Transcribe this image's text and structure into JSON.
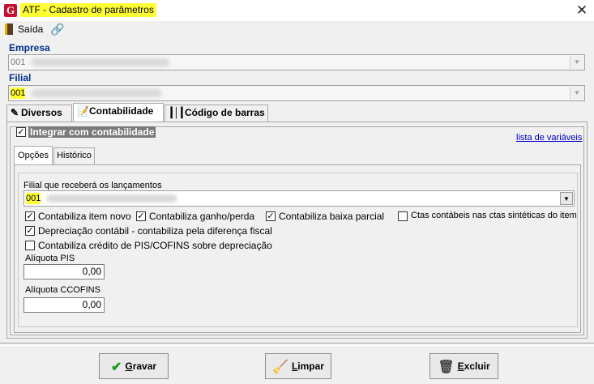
{
  "window": {
    "title": "ATF - Cadastro de parâmetros",
    "app_letter": "G",
    "close_glyph": "✕"
  },
  "toolbar": {
    "exit_label": "Saída"
  },
  "empresa": {
    "label": "Empresa",
    "code": "001"
  },
  "filial": {
    "label": "Filial",
    "code": "001"
  },
  "tabs": [
    {
      "label": "Diversos",
      "icon": "pencil-icon"
    },
    {
      "label": "Contabilidade",
      "icon": "edit-icon"
    },
    {
      "label": "Código de barras",
      "icon": "barcode-icon"
    }
  ],
  "contabilidade": {
    "integrar_label": "Integrar com contabilidade",
    "integrar_checked": true,
    "link_label": "lista de variáveis",
    "subtabs": [
      {
        "label": "Opções"
      },
      {
        "label": "Histórico"
      }
    ],
    "filial_label": "Filial que receberá os lançamentos",
    "filial_code": "001",
    "checks": [
      {
        "label": "Contabiliza item novo",
        "checked": true
      },
      {
        "label": "Contabiliza ganho/perda",
        "checked": true
      },
      {
        "label": "Contabiliza baixa parcial",
        "checked": true
      },
      {
        "label": "Ctas contábeis nas ctas sintéticas do item",
        "checked": false
      },
      {
        "label": "Depreciação contábil - contabiliza pela diferença fiscal",
        "checked": true
      },
      {
        "label": "Contabiliza crédito de PIS/COFINS sobre depreciação",
        "checked": false
      }
    ],
    "aliquota_pis_label": "Alíquota PIS",
    "aliquota_pis_value": "0,00",
    "aliquota_cofins_label": "Alíquota CCOFINS",
    "aliquota_cofins_value": "0,00"
  },
  "buttons": {
    "gravar": {
      "first": "G",
      "rest": "ravar"
    },
    "limpar": {
      "first": "L",
      "rest": "impar"
    },
    "excluir": {
      "first": "E",
      "rest": "xcluir"
    }
  },
  "colors": {
    "highlight": "#ffff33",
    "label_blue": "#002f8a",
    "link_blue": "#0000cc",
    "brand_red": "#c8102e"
  }
}
